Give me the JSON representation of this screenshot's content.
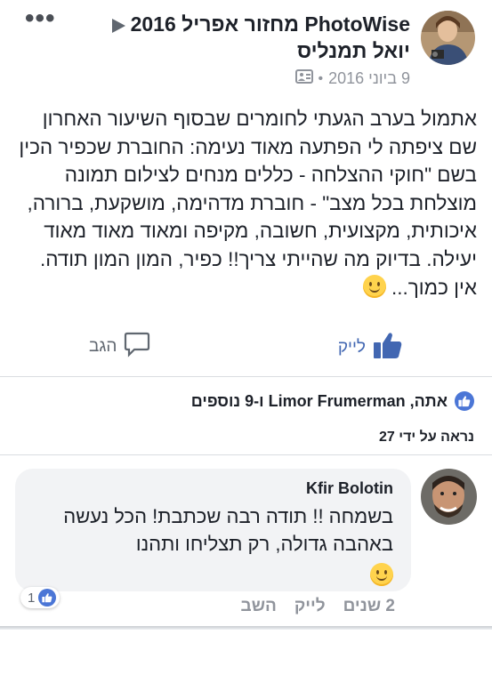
{
  "post": {
    "title_group": "PhotoWise מחזור אפריל 2016",
    "author": "יואל תמנליס",
    "date": "9 ביוני 2016",
    "more_label": "•••",
    "body": "אתמול בערב הגעתי לחומרים שבסוף השיעור האחרון שם ציפתה לי הפתעה מאוד נעימה: החוברת שכפיר הכין בשם \"חוקי ההצלחה - כללים מנחים לצילום תמונה מוצלחת בכל מצב\" - חוברת מדהימה, מושקעת, ברורה, איכותית, מקצועית, חשובה, מקיפה ומאוד מאוד מאוד יעילה. בדיוק מה שהייתי צריך!! כפיר, המון המון תודה. אין כמוך...",
    "like_label": "לייק",
    "comment_label": "הגב",
    "reactions_text": "אתה, Limor Frumerman ו-9 נוספים",
    "seen_text": "נראה על ידי 27"
  },
  "comment": {
    "name": "Kfir Bolotin",
    "text": "בשמחה !! תודה רבה שכתבת! הכל נעשה באהבה גדולה, רק תצליחו ותהנו",
    "like_count": "1",
    "time": "2 שנים",
    "like_label": "לייק",
    "reply_label": "השב"
  },
  "colors": {
    "accent": "#4267b2",
    "muted": "#90949c",
    "bubble": "#f2f3f5"
  },
  "icons": [
    "more-icon",
    "globe-audience-icon",
    "thumbs-up-icon",
    "comment-icon",
    "like-badge-icon",
    "smiley-emoji"
  ]
}
